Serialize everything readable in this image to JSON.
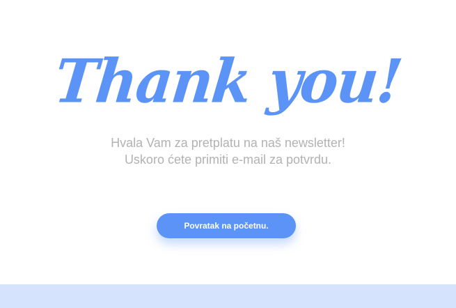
{
  "heading": "Thank you!",
  "message": {
    "line1": "Hvala Vam za pretplatu na naš newsletter!",
    "line2": "Uskoro ćete primiti e-mail za potvrdu."
  },
  "button": {
    "label": "Povratak na početnu."
  },
  "colors": {
    "accent": "#5b93f7",
    "text_muted": "#b2b2b2",
    "footer_band": "#d6e3fd"
  }
}
